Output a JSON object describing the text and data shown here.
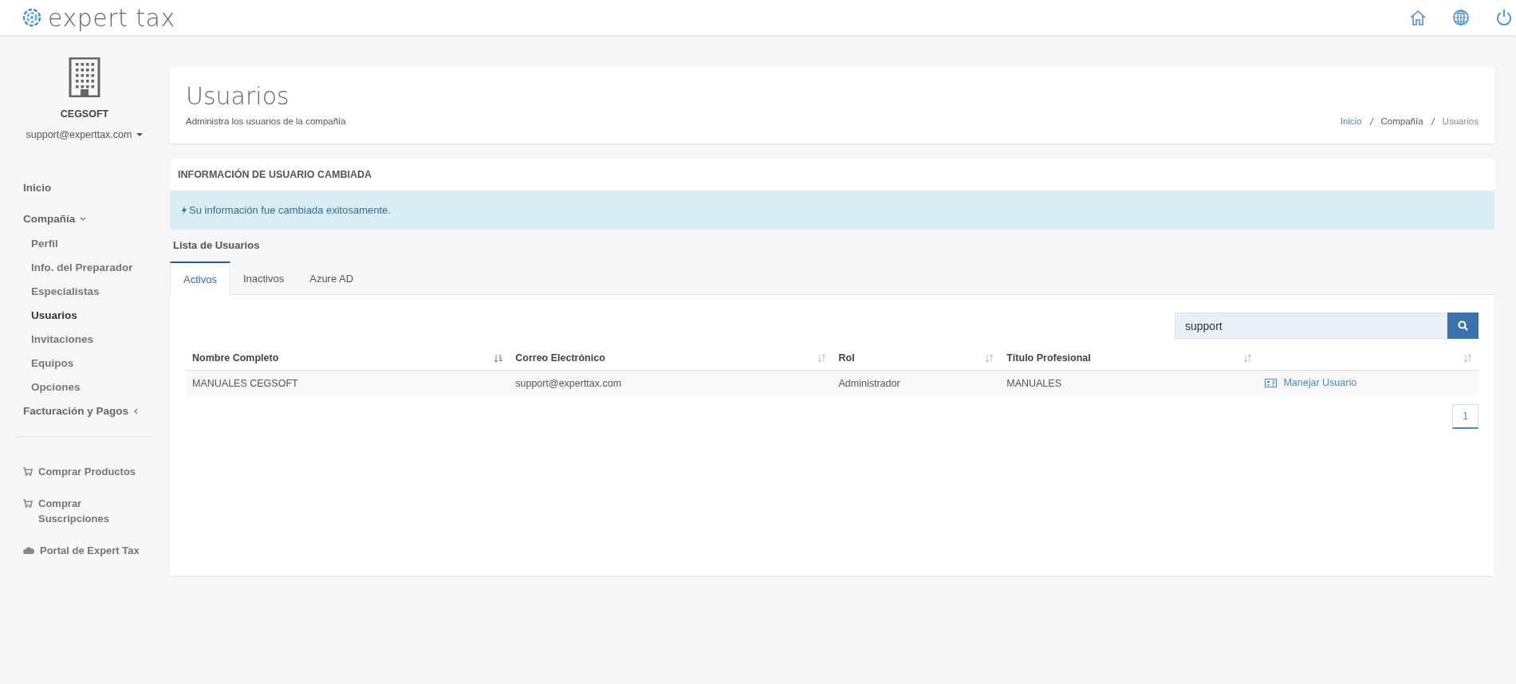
{
  "topbar": {
    "logo_text": "expert tax"
  },
  "sidebar": {
    "company": "CEGSOFT",
    "account": "support@experttax.com",
    "items": [
      {
        "label": "Inicio",
        "selected": false
      },
      {
        "label": "Compañía",
        "selected": false,
        "expanded": true,
        "children": [
          {
            "label": "Perfil",
            "selected": false
          },
          {
            "label": "Info. del Preparador",
            "selected": false
          },
          {
            "label": "Especialistas",
            "selected": false
          },
          {
            "label": "Usuarios",
            "selected": true
          },
          {
            "label": "Invitaciones",
            "selected": false
          },
          {
            "label": "Equipos",
            "selected": false
          },
          {
            "label": "Opciones",
            "selected": false
          }
        ]
      },
      {
        "label": "Facturación y Pagos",
        "selected": false,
        "expanded": false
      }
    ],
    "links": [
      {
        "label": "Comprar Productos",
        "kind": "cart"
      },
      {
        "label": "Comprar Suscripciones",
        "kind": "cart"
      },
      {
        "label": "Portal de Expert Tax",
        "kind": "cloud"
      }
    ]
  },
  "page_header": {
    "title": "Usuarios",
    "subtitle": "Administra los usuarios de la compañía",
    "breadcrumb": [
      {
        "label": "Inicio",
        "kind": "link"
      },
      {
        "label": "Compañía",
        "kind": "text"
      },
      {
        "label": "Usuarios",
        "kind": "current"
      }
    ]
  },
  "alert": {
    "title": "INFORMACIÓN DE USUARIO CAMBIADA",
    "message": "Su información fue cambiada exitosamente."
  },
  "user_list": {
    "title": "Lista de Usuarios",
    "tabs": [
      {
        "label": "Activos",
        "selected": true
      },
      {
        "label": "Inactivos",
        "selected": false
      },
      {
        "label": "Azure AD",
        "selected": false
      }
    ],
    "search": {
      "value": "support"
    },
    "columns": [
      {
        "label": "Nombre Completo",
        "sorted": true
      },
      {
        "label": "Correo Electrónico",
        "sorted": false
      },
      {
        "label": "Rol",
        "sorted": false
      },
      {
        "label": "Título Profesional",
        "sorted": false
      },
      {
        "sorted": false
      }
    ],
    "rows": [
      {
        "cells": [
          "MANUALES CEGSOFT",
          "support@experttax.com",
          "Administrador",
          "MANUALES"
        ],
        "action": "Manejar Usuario"
      }
    ],
    "pages": [
      {
        "label": "1",
        "selected": true
      }
    ]
  }
}
